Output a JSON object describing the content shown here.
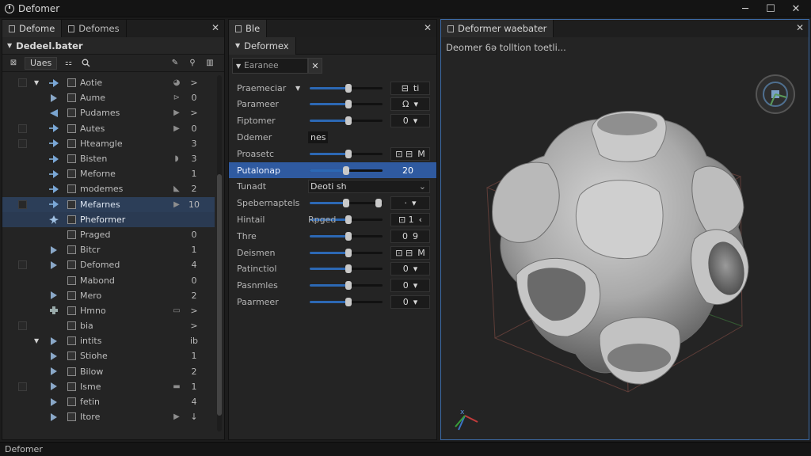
{
  "window": {
    "title": "Defomer",
    "minimize": "─",
    "maximize": "☐",
    "close": "✕"
  },
  "outliner": {
    "tabs": [
      {
        "label": "Defome"
      },
      {
        "label": "Defomes"
      }
    ],
    "close": "✕",
    "header": "Dedeel.bater",
    "filter_label": "Uaes",
    "rows": [
      {
        "name": "Aotie",
        "mini": "◕",
        "value": ">",
        "expanded": true
      },
      {
        "name": "Aume",
        "mini": "⊳",
        "value": "0"
      },
      {
        "name": "Pudames",
        "mini": "▶",
        "value": ">"
      },
      {
        "name": "Autes",
        "mini": "▶",
        "value": "0"
      },
      {
        "name": "Hteamgle",
        "mini": "",
        "value": "3"
      },
      {
        "name": "Bisten",
        "mini": "◗",
        "value": "3"
      },
      {
        "name": "Meforne",
        "mini": "",
        "value": "1"
      },
      {
        "name": "modemes",
        "mini": "◣",
        "value": "2"
      },
      {
        "name": "Mefarnes",
        "mini": "▶",
        "value": "10",
        "selected": true
      },
      {
        "name": "Pheformer",
        "mini": "",
        "value": "",
        "selected": true
      },
      {
        "name": "Praged",
        "mini": "",
        "value": "0"
      },
      {
        "name": "Bitcr",
        "mini": "",
        "value": "1"
      },
      {
        "name": "Defomed",
        "mini": "",
        "value": "4"
      },
      {
        "name": "Mabond",
        "mini": "",
        "value": "0"
      },
      {
        "name": "Mero",
        "mini": "",
        "value": "2"
      },
      {
        "name": "Hmno",
        "mini": "▭",
        "value": ">"
      },
      {
        "name": "bia",
        "mini": "",
        "value": ">"
      },
      {
        "name": "intits",
        "mini": "",
        "value": "ib",
        "expanded": true
      },
      {
        "name": "Stiohe",
        "mini": "",
        "value": "1"
      },
      {
        "name": "Bilow",
        "mini": "",
        "value": "2"
      },
      {
        "name": "Isme",
        "mini": "▬",
        "value": "1"
      },
      {
        "name": "fetin",
        "mini": "",
        "value": "4"
      },
      {
        "name": "Itore",
        "mini": "▶",
        "value": "↓"
      }
    ]
  },
  "properties": {
    "tab_label": "Ble",
    "close": "✕",
    "subtab": "Deformex",
    "search_placeholder": "Earanee",
    "search_clear": "✕",
    "rows": [
      {
        "label": "Praemeciar",
        "slider": 0.53,
        "field_a": "⊟",
        "field_b": "ti",
        "has_dropdown": true
      },
      {
        "label": "Parameer",
        "slider": 0.53,
        "field_a": "Ω",
        "field_b": "▾"
      },
      {
        "label": "Fiptomer",
        "slider": 0.53,
        "field_a": "0",
        "field_b": "▾"
      },
      {
        "label": "Ddemer",
        "small": "nes"
      },
      {
        "label": "Proasetc",
        "slider": 0.53,
        "field_a": "⊡ ⊟",
        "field_b": "M"
      },
      {
        "label": "Putalonap",
        "slider": 0.5,
        "field_a": "20",
        "field_b": "",
        "selected": true
      },
      {
        "label": "Tunadt",
        "text": "Deoti sh",
        "text_arrow": "⌄"
      },
      {
        "label": "Spebernaptels",
        "slider": 0.5,
        "slider2": 0.95,
        "field_a": "·",
        "field_b": "▾"
      },
      {
        "label": "Hintail",
        "plain": "Rpged",
        "slider": 0.53,
        "field_a": "⊡ 1",
        "field_b": "‹"
      },
      {
        "label": "Thre",
        "slider": 0.53,
        "field_a": "0",
        "field_b": "9"
      },
      {
        "label": "Deismen",
        "slider": 0.53,
        "field_a": "⊡ ⊟",
        "field_b": "M"
      },
      {
        "label": "Patinctiol",
        "slider": 0.53,
        "field_a": "0",
        "field_b": "▾"
      },
      {
        "label": "Pasnmles",
        "slider": 0.53,
        "field_a": "0",
        "field_b": "▾"
      },
      {
        "label": "Paarmeer",
        "slider": 0.53,
        "field_a": "0",
        "field_b": "▾"
      }
    ]
  },
  "viewport": {
    "tab_label": "Deformer waebater",
    "close": "✕",
    "overlay": "Deomer 6ə tolltion toetli..."
  },
  "status": {
    "text": "Defomer"
  },
  "colors": {
    "accent": "#2f5aa0",
    "selection": "#2c3e58",
    "viewport_border": "#3d6ca8"
  }
}
